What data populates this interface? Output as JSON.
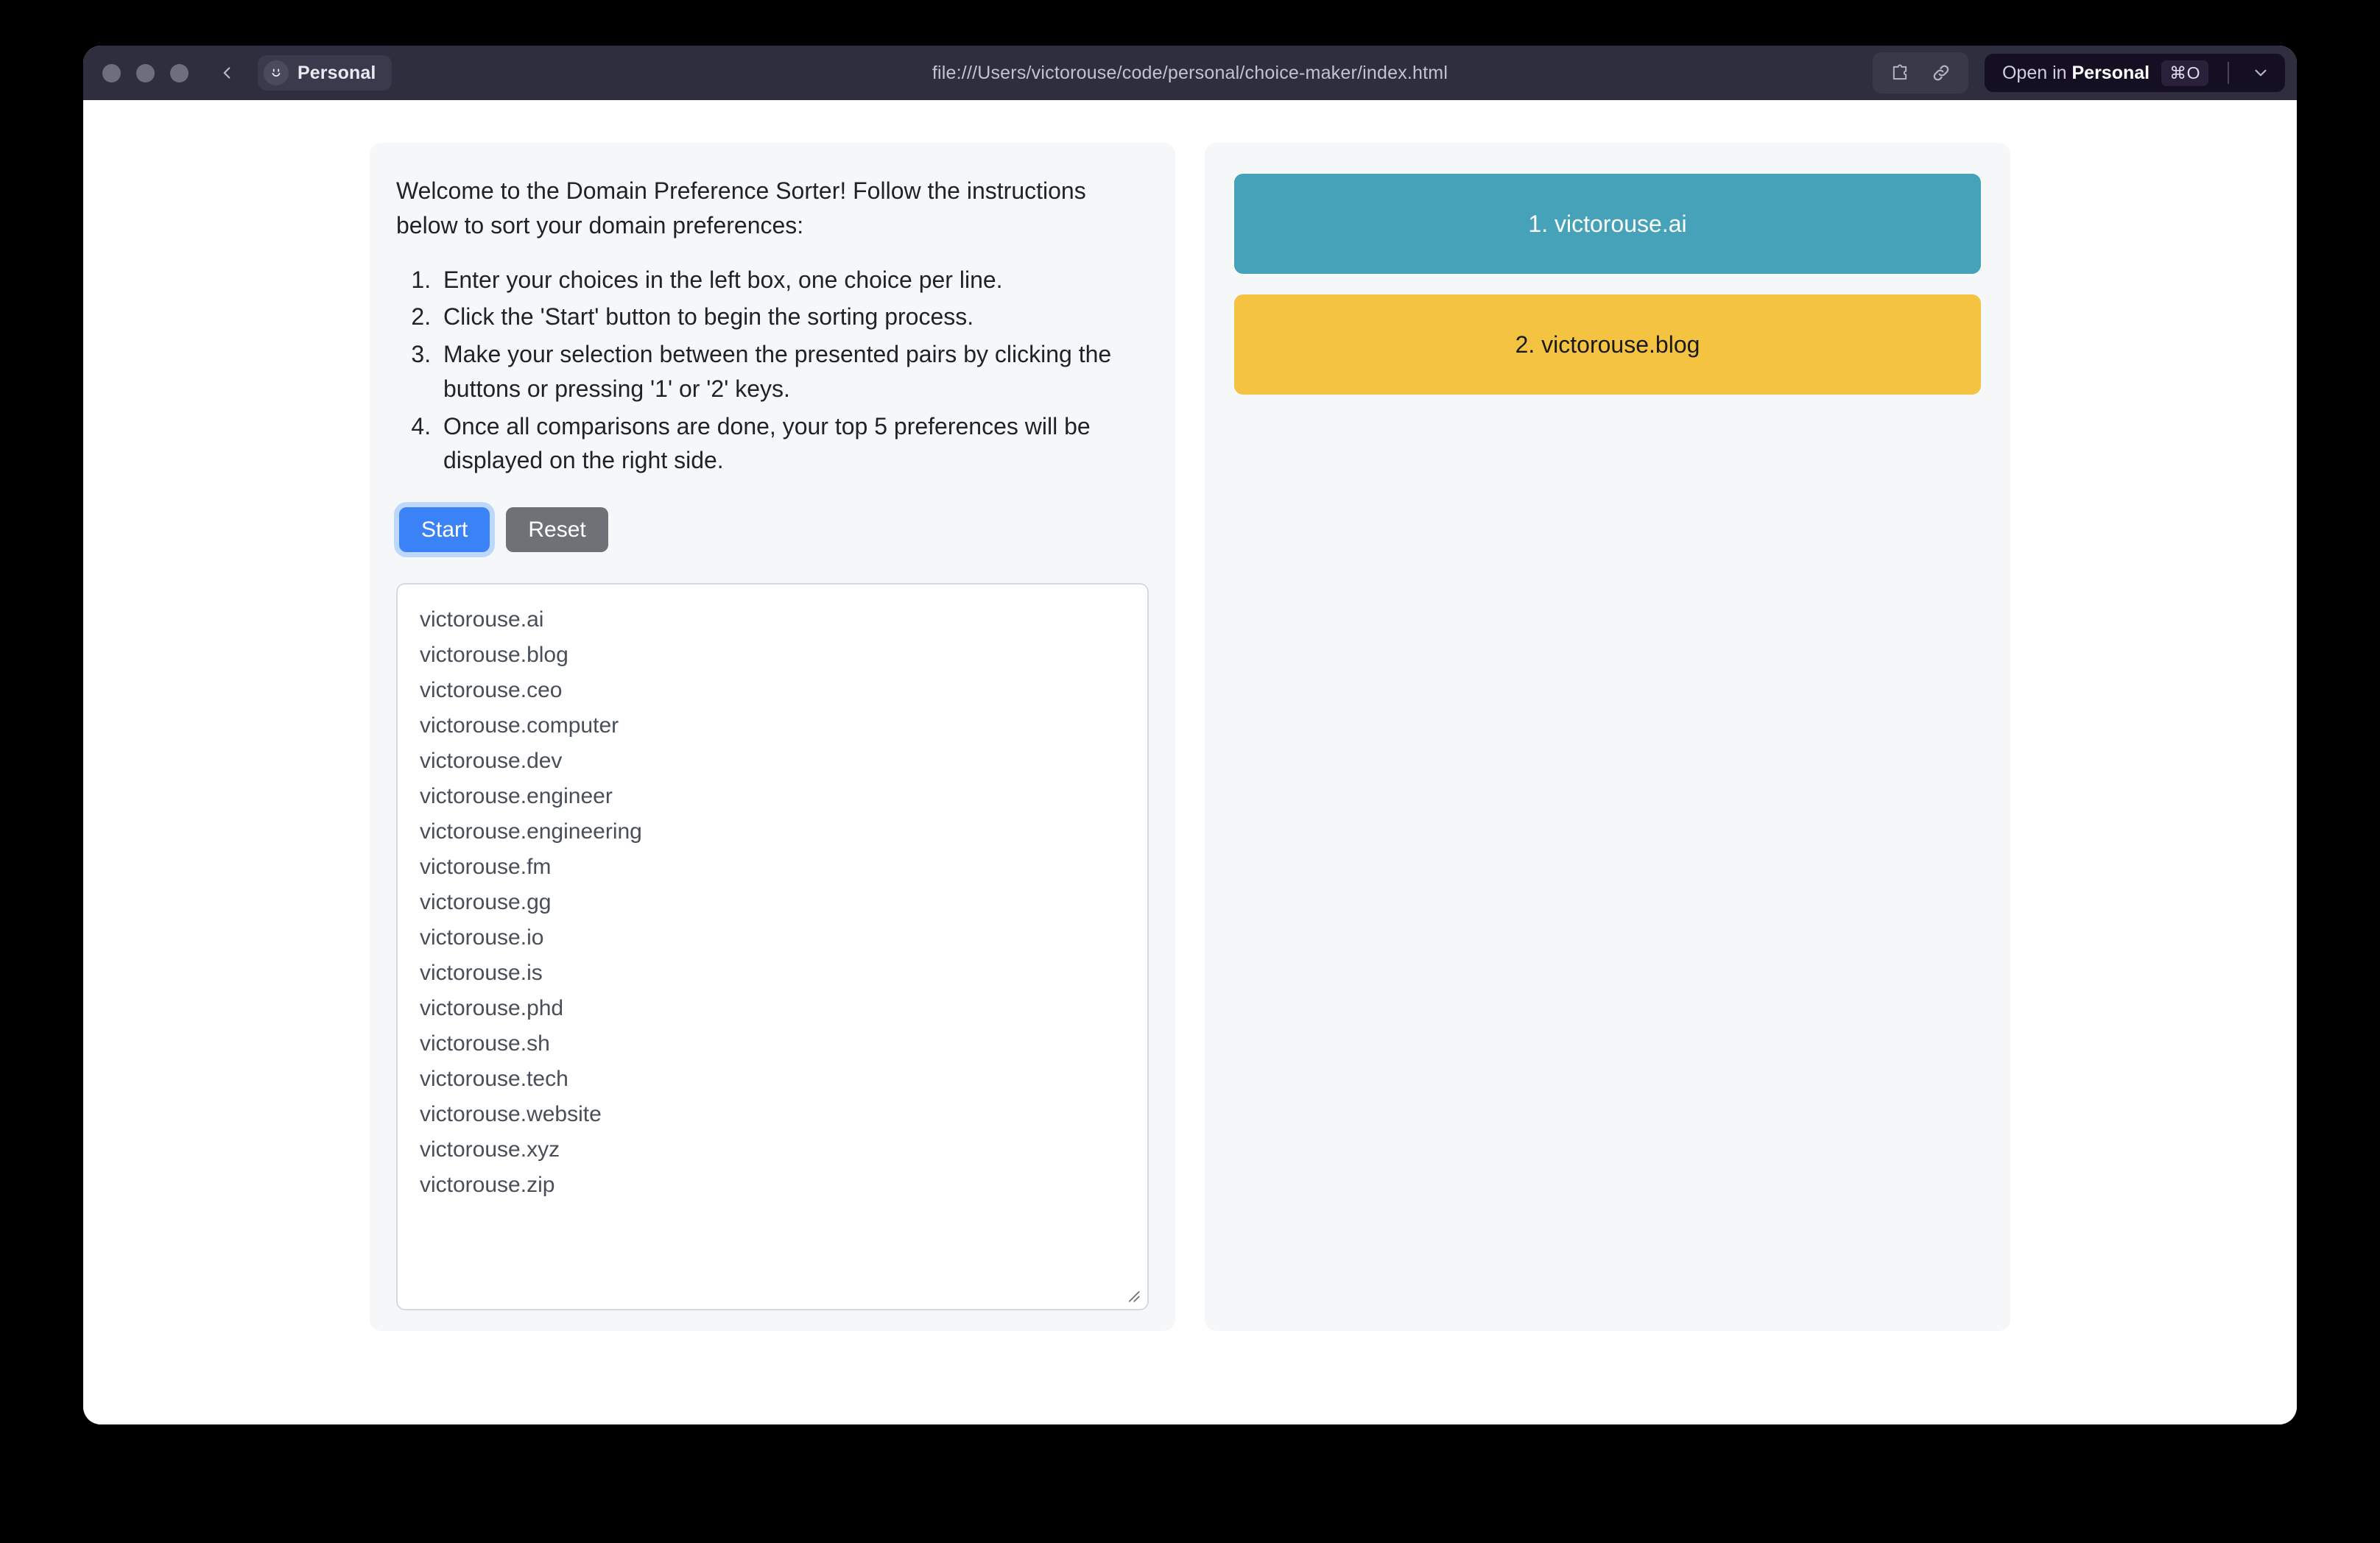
{
  "titlebar": {
    "profile_label": "Personal",
    "profile_avatar_icon": "smiley-face-icon",
    "back_icon": "chevron-left-icon",
    "url": "file:///Users/victorouse/code/personal/choice-maker/index.html",
    "extensions_icon": "puzzle-piece-icon",
    "link_icon": "link-icon",
    "open_prefix": "Open in ",
    "open_profile": "Personal",
    "open_shortcut": "⌘O",
    "caret_icon": "chevron-down-icon",
    "traffic_lights": [
      "close",
      "minimize",
      "zoom"
    ]
  },
  "instructions": {
    "intro": "Welcome to the Domain Preference Sorter! Follow the instructions below to sort your domain preferences:",
    "steps": [
      "Enter your choices in the left box, one choice per line.",
      "Click the 'Start' button to begin the sorting process.",
      "Make your selection between the presented pairs by clicking the buttons or pressing '1' or '2' keys.",
      "Once all comparisons are done, your top 5 preferences will be displayed on the right side."
    ]
  },
  "controls": {
    "start_label": "Start",
    "reset_label": "Reset",
    "start_color": "#3b82f6",
    "reset_color": "#6e7277"
  },
  "choices_input": {
    "lines": [
      "victorouse.ai",
      "victorouse.blog",
      "victorouse.ceo",
      "victorouse.computer",
      "victorouse.dev",
      "victorouse.engineer",
      "victorouse.engineering",
      "victorouse.fm",
      "victorouse.gg",
      "victorouse.io",
      "victorouse.is",
      "victorouse.phd",
      "victorouse.sh",
      "victorouse.tech",
      "victorouse.website",
      "victorouse.xyz",
      "victorouse.zip"
    ],
    "resize_handle_icon": "resize-grip-icon"
  },
  "results": {
    "items": [
      {
        "label": "1. victorouse.ai",
        "color": "#46a2b8",
        "text_color": "#ffffff"
      },
      {
        "label": "2. victorouse.blog",
        "color": "#f5c342",
        "text_color": "#1a1a1a"
      }
    ]
  }
}
